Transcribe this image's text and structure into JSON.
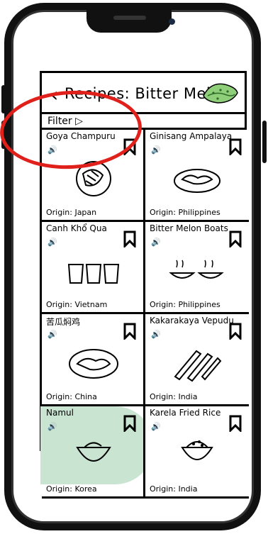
{
  "header": {
    "back_icon": "chevron-left-icon",
    "title": "Recipes: Bitter Melon",
    "icon": "bitter-melon-icon"
  },
  "filter": {
    "label": "Filter ▷"
  },
  "recipes": [
    {
      "name": "Goya Champuru",
      "origin": "Origin: Japan",
      "sound": "🔊"
    },
    {
      "name": "Ginisang Ampalaya",
      "origin": "Origin: Philippines",
      "sound": "🔊"
    },
    {
      "name": "Canh Khổ Qua",
      "origin": "Origin: Vietnam",
      "sound": "🔊"
    },
    {
      "name": "Bitter Melon Boats",
      "origin": "Origin: Philippines",
      "sound": "🔊"
    },
    {
      "name": "苦瓜焖鸡",
      "origin": "Origin: China",
      "sound": "🔊"
    },
    {
      "name": "Kakarakaya Vepudu",
      "origin": "Origin: India",
      "sound": "🔊"
    },
    {
      "name": "Namul",
      "origin": "Origin: Korea",
      "sound": "🔊"
    },
    {
      "name": "Karela Fried Rice",
      "origin": "Origin: India",
      "sound": "🔊"
    }
  ],
  "colors": {
    "highlight": "#c9e4d1",
    "annotation": "#e0201b"
  }
}
